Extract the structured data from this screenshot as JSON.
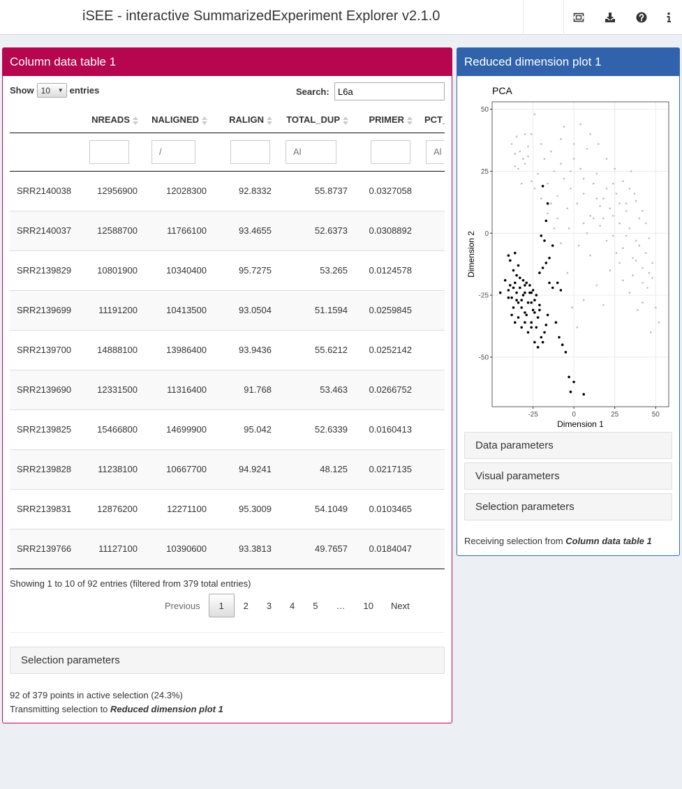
{
  "header": {
    "title": "iSEE - interactive SummarizedExperiment Explorer v2.1.0"
  },
  "column_table": {
    "title": "Column data table 1",
    "show_label": "Show",
    "entries_label": "entries",
    "page_length": "10",
    "search_label": "Search:",
    "search_value": "L6a",
    "columns": [
      "NREADS",
      "NALIGNED",
      "RALIGN",
      "TOTAL_DUP",
      "PRIMER",
      "PCT_"
    ],
    "filter_placeholders": [
      "",
      "/",
      "",
      "Al",
      "",
      "Al"
    ],
    "rows": [
      {
        "name": "SRR2140038",
        "values": [
          "12956900",
          "12028300",
          "92.8332",
          "55.8737",
          "0.0327058"
        ]
      },
      {
        "name": "SRR2140037",
        "values": [
          "12588700",
          "11766100",
          "93.4655",
          "52.6373",
          "0.0308892"
        ]
      },
      {
        "name": "SRR2139829",
        "values": [
          "10801900",
          "10340400",
          "95.7275",
          "53.265",
          "0.0124578"
        ]
      },
      {
        "name": "SRR2139699",
        "values": [
          "11191200",
          "10413500",
          "93.0504",
          "51.1594",
          "0.0259845"
        ]
      },
      {
        "name": "SRR2139700",
        "values": [
          "14888100",
          "13986400",
          "93.9436",
          "55.6212",
          "0.0252142"
        ]
      },
      {
        "name": "SRR2139690",
        "values": [
          "12331500",
          "11316400",
          "91.768",
          "53.463",
          "0.0266752"
        ]
      },
      {
        "name": "SRR2139825",
        "values": [
          "15466800",
          "14699900",
          "95.042",
          "52.6339",
          "0.0160413"
        ]
      },
      {
        "name": "SRR2139828",
        "values": [
          "11238100",
          "10667700",
          "94.9241",
          "48.125",
          "0.0217135"
        ]
      },
      {
        "name": "SRR2139831",
        "values": [
          "12876200",
          "12271100",
          "95.3009",
          "54.1049",
          "0.0103465"
        ]
      },
      {
        "name": "SRR2139766",
        "values": [
          "11127100",
          "10390600",
          "93.3813",
          "49.7657",
          "0.0184047"
        ]
      }
    ],
    "info": "Showing 1 to 10 of 92 entries (filtered from 379 total entries)",
    "pagination": {
      "previous": "Previous",
      "pages": [
        "1",
        "2",
        "3",
        "4",
        "5",
        "…",
        "10"
      ],
      "current": "1",
      "next": "Next"
    },
    "selection_parameters": "Selection parameters",
    "status_line": "92 of 379 points in active selection (24.3%)",
    "transmit_prefix": "Transmitting selection to ",
    "transmit_target": "Reduced dimension plot 1"
  },
  "reduced_dim_plot": {
    "title": "Reduced dimension plot 1",
    "data_parameters": "Data parameters",
    "visual_parameters": "Visual parameters",
    "selection_parameters": "Selection parameters",
    "receive_prefix": "Receiving selection from ",
    "receive_source": "Column data table 1"
  },
  "chart_data": {
    "type": "scatter",
    "title": "PCA",
    "xlabel": "Dimension 1",
    "ylabel": "Dimension 2",
    "xlim": [
      -50,
      58
    ],
    "ylim": [
      -70,
      53
    ],
    "xticks": [
      -25,
      0,
      25,
      50
    ],
    "yticks": [
      50,
      25,
      0,
      -25,
      -50
    ],
    "grid": true,
    "series": [
      {
        "color": "#bbbbbb",
        "points": [
          [
            -38,
            36
          ],
          [
            -35,
            39
          ],
          [
            -33,
            33
          ],
          [
            -31,
            30
          ],
          [
            -36,
            27
          ],
          [
            -30,
            28
          ],
          [
            -28,
            31
          ],
          [
            -34,
            26
          ],
          [
            -26,
            21
          ],
          [
            -24,
            18
          ],
          [
            -22,
            24
          ],
          [
            -20,
            14
          ],
          [
            -18,
            30
          ],
          [
            -16,
            20
          ],
          [
            -14,
            33
          ],
          [
            -12,
            25
          ],
          [
            -10,
            15
          ],
          [
            -8,
            38
          ],
          [
            -6,
            22
          ],
          [
            -4,
            10
          ],
          [
            -2,
            18
          ],
          [
            0,
            30
          ],
          [
            2,
            12
          ],
          [
            4,
            26
          ],
          [
            6,
            16
          ],
          [
            8,
            34
          ],
          [
            10,
            7
          ],
          [
            12,
            20
          ],
          [
            14,
            24
          ],
          [
            16,
            3
          ],
          [
            18,
            14
          ],
          [
            20,
            18
          ],
          [
            22,
            10
          ],
          [
            24,
            -1
          ],
          [
            26,
            16
          ],
          [
            28,
            4
          ],
          [
            30,
            -6
          ],
          [
            32,
            9
          ],
          [
            34,
            2
          ],
          [
            36,
            -10
          ],
          [
            38,
            -3
          ],
          [
            40,
            6
          ],
          [
            42,
            -14
          ],
          [
            44,
            -8
          ],
          [
            46,
            -2
          ],
          [
            48,
            -18
          ],
          [
            50,
            -30
          ],
          [
            52,
            -36
          ],
          [
            -24,
            48
          ],
          [
            -6,
            43
          ],
          [
            -16,
            8
          ],
          [
            -12,
            2
          ],
          [
            -8,
            -4
          ],
          [
            -4,
            -16
          ],
          [
            -1,
            -30
          ],
          [
            2,
            -38
          ],
          [
            6,
            -27
          ],
          [
            10,
            -9
          ],
          [
            14,
            -21
          ],
          [
            18,
            -29
          ],
          [
            22,
            -15
          ],
          [
            26,
            -8
          ],
          [
            30,
            -19
          ],
          [
            34,
            -24
          ],
          [
            38,
            -11
          ],
          [
            42,
            -28
          ],
          [
            45,
            -22
          ],
          [
            -3,
            2
          ],
          [
            3,
            -5
          ],
          [
            8,
            0
          ],
          [
            12,
            6
          ],
          [
            16,
            11
          ],
          [
            20,
            -3
          ],
          [
            24,
            7
          ],
          [
            28,
            -12
          ],
          [
            32,
            -1
          ],
          [
            36,
            -17
          ],
          [
            40,
            -5
          ],
          [
            44,
            4
          ],
          [
            48,
            -12
          ],
          [
            30,
            21
          ],
          [
            34,
            18
          ],
          [
            38,
            13
          ],
          [
            42,
            9
          ],
          [
            -30,
            40
          ],
          [
            -28,
            35
          ],
          [
            -26,
            40
          ],
          [
            -32,
            20
          ],
          [
            0,
            36
          ],
          [
            4,
            44
          ],
          [
            10,
            40
          ],
          [
            15,
            36
          ],
          [
            20,
            30
          ],
          [
            25,
            26
          ],
          [
            35,
            25
          ],
          [
            37,
            16
          ],
          [
            -14,
            12
          ],
          [
            -10,
            6
          ],
          [
            6,
            4
          ],
          [
            18,
            6
          ],
          [
            28,
            12
          ],
          [
            -20,
            36
          ],
          [
            -36,
            32
          ],
          [
            -2,
            25
          ],
          [
            6,
            22
          ],
          [
            14,
            14
          ],
          [
            24,
            20
          ],
          [
            32,
            12
          ],
          [
            -8,
            28
          ],
          [
            42,
            -20
          ],
          [
            46,
            -16
          ],
          [
            39,
            -31
          ],
          [
            47,
            -40
          ]
        ]
      },
      {
        "color": "#000000",
        "points": [
          [
            -45,
            -24
          ],
          [
            -42,
            -19
          ],
          [
            -40,
            -23
          ],
          [
            -39,
            -21
          ],
          [
            -38,
            -26
          ],
          [
            -37,
            -22
          ],
          [
            -36,
            -20
          ],
          [
            -35,
            -24
          ],
          [
            -34,
            -28
          ],
          [
            -33,
            -22
          ],
          [
            -32,
            -30
          ],
          [
            -31,
            -25
          ],
          [
            -30,
            -21
          ],
          [
            -29,
            -33
          ],
          [
            -28,
            -28
          ],
          [
            -27,
            -24
          ],
          [
            -26,
            -36
          ],
          [
            -25,
            -31
          ],
          [
            -24,
            -27
          ],
          [
            -23,
            -38
          ],
          [
            -22,
            -34
          ],
          [
            -21,
            -29
          ],
          [
            -20,
            -42
          ],
          [
            -19,
            -44
          ],
          [
            -18,
            -40
          ],
          [
            -17,
            -37
          ],
          [
            -16,
            -33
          ],
          [
            -38,
            -33
          ],
          [
            -36,
            -36
          ],
          [
            -34,
            -34
          ],
          [
            -32,
            -38
          ],
          [
            -30,
            -36
          ],
          [
            -28,
            -40
          ],
          [
            -26,
            -38
          ],
          [
            -24,
            -44
          ],
          [
            -22,
            -46
          ],
          [
            -40,
            -26
          ],
          [
            -37,
            -30
          ],
          [
            -35,
            -17
          ],
          [
            -33,
            -18
          ],
          [
            -31,
            -19
          ],
          [
            -29,
            -20
          ],
          [
            -27,
            -21
          ],
          [
            -25,
            -23
          ],
          [
            -23,
            -25
          ],
          [
            -21,
            -16
          ],
          [
            -19,
            -14
          ],
          [
            -17,
            -12
          ],
          [
            -15,
            -10
          ],
          [
            -13,
            -5
          ],
          [
            -11,
            -36
          ],
          [
            -9,
            -42
          ],
          [
            -7,
            -45
          ],
          [
            -5,
            -48
          ],
          [
            -18,
            -3
          ],
          [
            -20,
            -1
          ],
          [
            -17,
            5
          ],
          [
            -16,
            12
          ],
          [
            -19,
            19
          ],
          [
            -15,
            -20
          ],
          [
            -13,
            -22
          ],
          [
            -10,
            -20
          ],
          [
            -8,
            -23
          ],
          [
            -39,
            -11
          ],
          [
            -36,
            -8
          ],
          [
            -34,
            -13
          ],
          [
            -40,
            -9
          ],
          [
            -37,
            -15
          ],
          [
            -32,
            -27
          ],
          [
            -30,
            -32
          ],
          [
            -26,
            -28
          ],
          [
            -24,
            -32
          ],
          [
            -3,
            -58
          ],
          [
            0,
            -60
          ],
          [
            -2,
            -64
          ],
          [
            6,
            -65
          ],
          [
            -21,
            -31
          ],
          [
            -26,
            -24
          ],
          [
            -30,
            -24
          ],
          [
            -35,
            -27
          ]
        ]
      }
    ]
  }
}
